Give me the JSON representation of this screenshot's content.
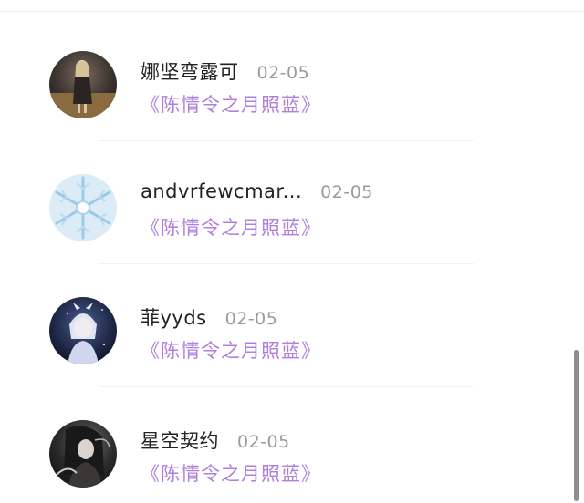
{
  "comments": [
    {
      "username": "娜坚弯露可",
      "date": "02-05",
      "work_title": "《陈情令之月照蓝》",
      "avatar_icon": "night-girl-avatar"
    },
    {
      "username": "andvrfewcmar...",
      "date": "02-05",
      "work_title": "《陈情令之月照蓝》",
      "avatar_icon": "snowflake-avatar"
    },
    {
      "username": "菲yyds",
      "date": "02-05",
      "work_title": "《陈情令之月照蓝》",
      "avatar_icon": "anime-character-avatar"
    },
    {
      "username": "星空契约",
      "date": "02-05",
      "work_title": "《陈情令之月照蓝》",
      "avatar_icon": "dark-anime-avatar"
    }
  ],
  "colors": {
    "username": "#222222",
    "date": "#9a9a9a",
    "work_title": "#b07fdc",
    "scrollbar": "#8d8d8d"
  }
}
